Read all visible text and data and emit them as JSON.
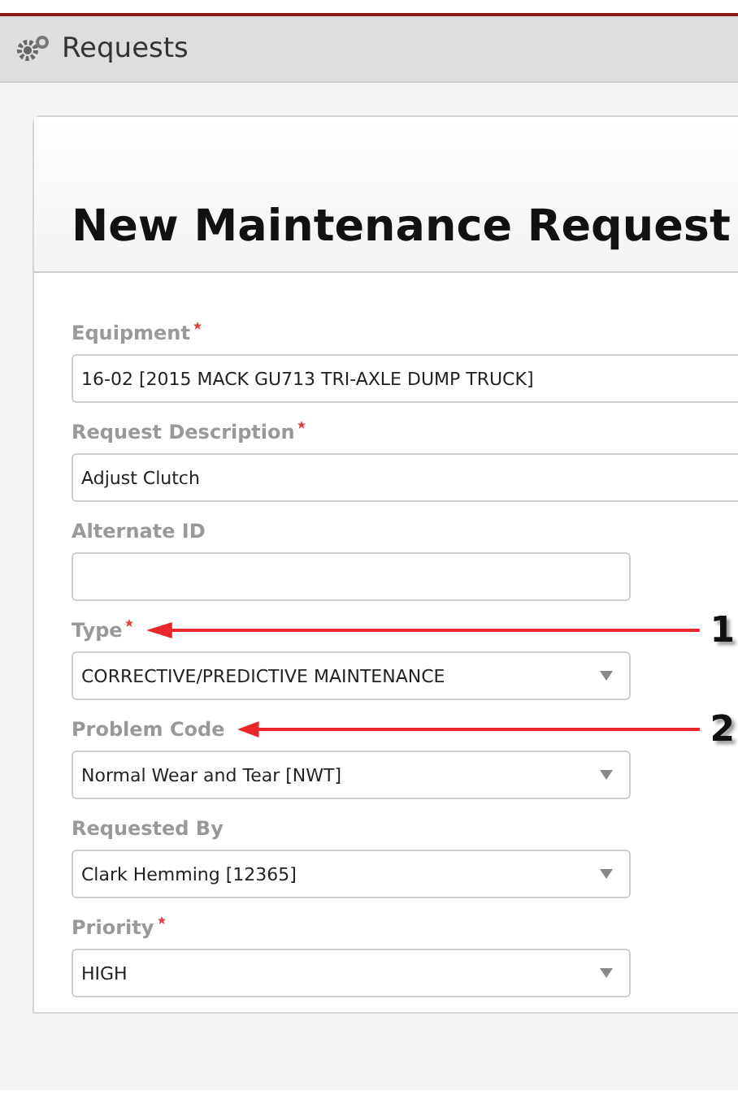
{
  "header": {
    "title": "Requests"
  },
  "form": {
    "title": "New Maintenance Request",
    "fields": [
      {
        "label": "Equipment",
        "required": true,
        "kind": "wide_text",
        "value": "16-02 [2015 MACK GU713 TRI-AXLE DUMP TRUCK]"
      },
      {
        "label": "Request Description",
        "required": true,
        "kind": "wide_text",
        "value": "Adjust Clutch"
      },
      {
        "label": "Alternate ID",
        "required": false,
        "kind": "text"
      },
      {
        "label": "Type",
        "required": true,
        "kind": "select",
        "value": "CORRECTIVE/PREDICTIVE MAINTENANCE",
        "callout": "1"
      },
      {
        "label": "Problem Code",
        "required": false,
        "kind": "select",
        "value": "Normal Wear and Tear [NWT]",
        "callout": "2"
      },
      {
        "label": "Requested By",
        "required": false,
        "kind": "select",
        "value": "Clark Hemming [12365]"
      },
      {
        "label": "Priority",
        "required": true,
        "kind": "select",
        "value": "HIGH"
      }
    ]
  }
}
